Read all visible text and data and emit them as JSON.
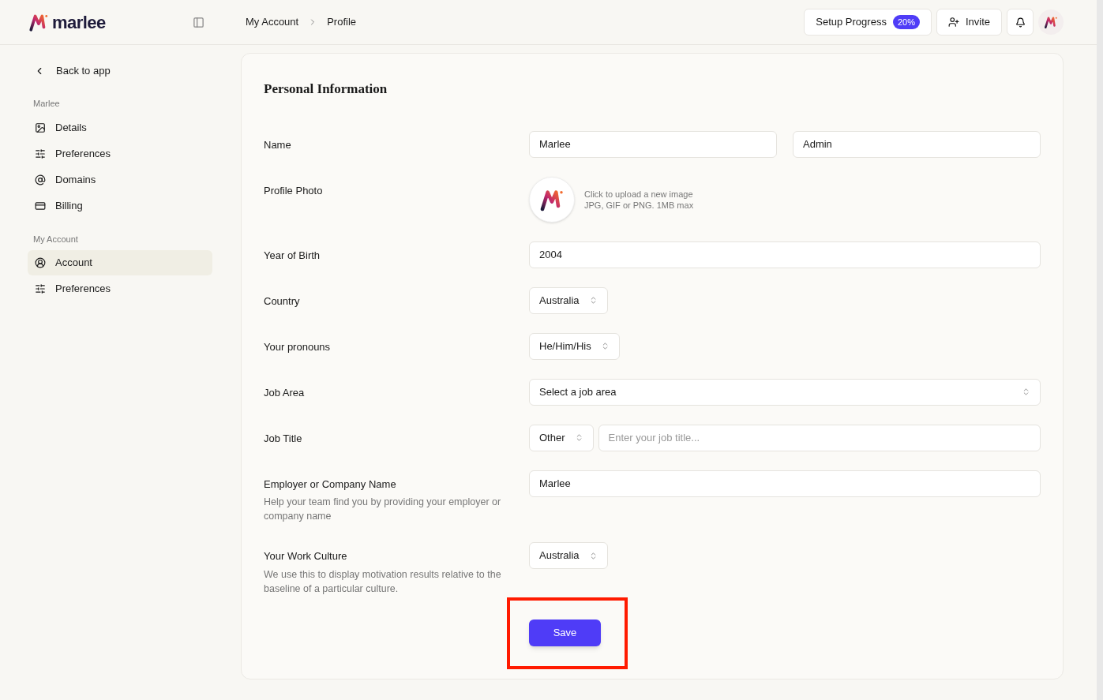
{
  "header": {
    "logo": "marlee",
    "breadcrumb": [
      "My Account",
      "Profile"
    ],
    "setup_button": {
      "label": "Setup Progress",
      "badge": "20%"
    },
    "invite_button": "Invite"
  },
  "sidebar": {
    "back": "Back to app",
    "sections": [
      {
        "title": "Marlee",
        "items": [
          {
            "label": "Details",
            "kind": "image",
            "selected": false
          },
          {
            "label": "Preferences",
            "kind": "sliders",
            "selected": false
          },
          {
            "label": "Domains",
            "kind": "at",
            "selected": false
          },
          {
            "label": "Billing",
            "kind": "card",
            "selected": false
          }
        ]
      },
      {
        "title": "My Account",
        "items": [
          {
            "label": "Account",
            "kind": "user",
            "selected": true
          },
          {
            "label": "Preferences",
            "kind": "sliders",
            "selected": false
          }
        ]
      }
    ]
  },
  "form": {
    "title": "Personal Information",
    "fields": [
      {
        "kind": "pair",
        "label": "Name",
        "values": [
          "Marlee",
          "Admin"
        ]
      },
      {
        "kind": "photo",
        "label": "Profile Photo",
        "hint": [
          "Click to upload a new image",
          "JPG, GIF or PNG. 1MB max"
        ]
      },
      {
        "kind": "text",
        "label": "Year of Birth",
        "value": "2004"
      },
      {
        "kind": "select",
        "label": "Country",
        "value": "Australia"
      },
      {
        "kind": "select",
        "label": "Your pronouns",
        "value": "He/Him/His"
      },
      {
        "kind": "select_wide",
        "label": "Job Area",
        "value": "Select a job area"
      },
      {
        "kind": "select_input",
        "label": "Job Title",
        "value": "Other",
        "placeholder": "Enter your job title..."
      },
      {
        "kind": "text",
        "label": "Employer or Company Name",
        "help": "Help your team find you by providing your employer or company name",
        "value": "Marlee"
      },
      {
        "kind": "select",
        "label": "Your Work Culture",
        "help": "We use this to display motivation results relative to the baseline of a particular culture.",
        "value": "Australia"
      }
    ],
    "save": "Save"
  }
}
